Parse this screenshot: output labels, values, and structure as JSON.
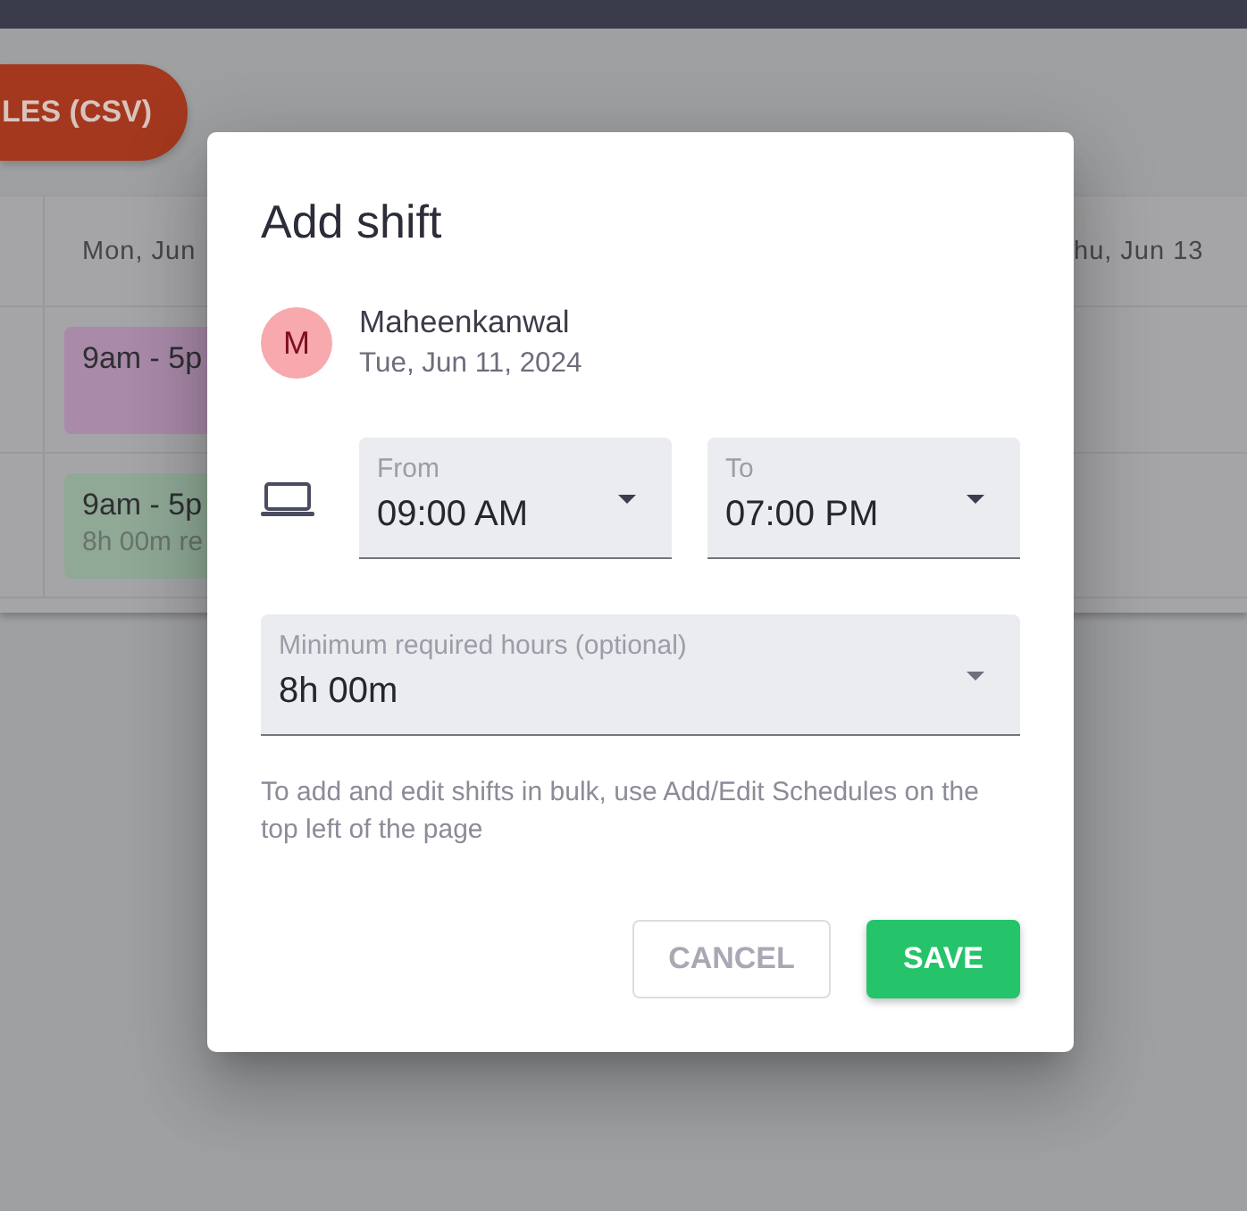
{
  "background": {
    "export_button": {
      "label": "LES (CSV)"
    },
    "schedule": {
      "columns": [
        "Mon, Jun",
        "hu, Jun 13"
      ],
      "rows": [
        {
          "shifts": [
            {
              "time": "9am - 5p",
              "color": "#a98aa9"
            }
          ]
        },
        {
          "shifts": [
            {
              "time": "9am - 5p",
              "detail": "8h 00m re",
              "color": "#8fa996"
            }
          ]
        }
      ]
    }
  },
  "dialog": {
    "title": "Add shift",
    "employee": {
      "initial": "M",
      "name": "Maheenkanwal",
      "date": "Tue, Jun 11, 2024"
    },
    "time_fields": [
      {
        "label": "From",
        "value": "09:00 AM"
      },
      {
        "label": "To",
        "value": "07:00 PM"
      }
    ],
    "minimum_hours": {
      "label": "Minimum required hours (optional)",
      "value": "8h 00m"
    },
    "helper_text": "To add and edit shifts in bulk, use Add/Edit Schedules on the top left of the page",
    "buttons": [
      {
        "label": "CANCEL",
        "kind": "secondary"
      },
      {
        "label": "SAVE",
        "kind": "primary"
      }
    ]
  }
}
